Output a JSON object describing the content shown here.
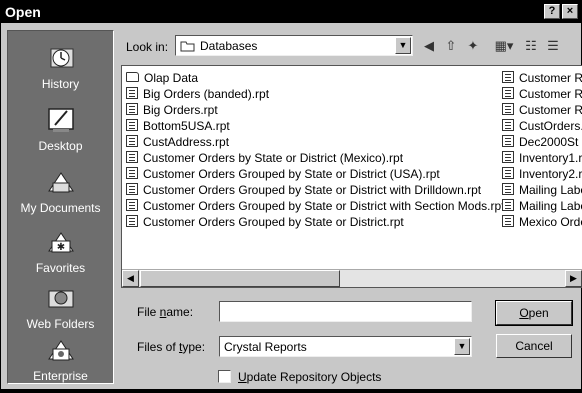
{
  "title": "Open",
  "title_buttons": {
    "help": "?",
    "close": "×"
  },
  "places": [
    {
      "label": "History",
      "icon": "history-icon"
    },
    {
      "label": "Desktop",
      "icon": "desktop-icon"
    },
    {
      "label": "My Documents",
      "icon": "my-documents-icon"
    },
    {
      "label": "Favorites",
      "icon": "favorites-icon"
    },
    {
      "label": "Web Folders",
      "icon": "web-folders-icon"
    },
    {
      "label": "Enterprise",
      "icon": "enterprise-icon"
    }
  ],
  "look_in": {
    "label": "Look in:",
    "value": "Databases"
  },
  "toolbar": [
    "back-icon",
    "up-folder-icon",
    "new-folder-icon",
    "views-icon",
    "list-view-icon",
    "details-view-icon"
  ],
  "files_col1": [
    {
      "name": "Olap Data",
      "type": "folder"
    },
    {
      "name": "Big Orders (banded).rpt",
      "type": "file"
    },
    {
      "name": "Big Orders.rpt",
      "type": "file"
    },
    {
      "name": "Bottom5USA.rpt",
      "type": "file"
    },
    {
      "name": "CustAddress.rpt",
      "type": "file"
    },
    {
      "name": "Customer Orders by State or District (Mexico).rpt",
      "type": "file"
    },
    {
      "name": "Customer Orders Grouped by State or District (USA).rpt",
      "type": "file"
    },
    {
      "name": "Customer Orders Grouped by State or District with Drilldown.rpt",
      "type": "file"
    },
    {
      "name": "Customer Orders Grouped by State or District with Section Mods.rpt",
      "type": "file"
    },
    {
      "name": "Customer Orders Grouped by State or District.rpt",
      "type": "file"
    }
  ],
  "files_col2": [
    "Customer R",
    "Customer R",
    "Customer R",
    "CustOrders.",
    "Dec2000St",
    "Inventory1.r",
    "Inventory2.r",
    "Mailing Labe",
    "Mailing Labe",
    "Mexico Orde"
  ],
  "file_name": {
    "label_pre": "File ",
    "label_u": "n",
    "label_post": "ame:",
    "value": ""
  },
  "file_type": {
    "label_pre": "Files of ",
    "label_u": "t",
    "label_post": "ype:",
    "value": "Crystal Reports"
  },
  "buttons": {
    "open_u": "O",
    "open_rest": "pen",
    "cancel": "Cancel"
  },
  "checkbox": {
    "label_u": "U",
    "label_rest": "pdate Repository Objects",
    "checked": false
  }
}
